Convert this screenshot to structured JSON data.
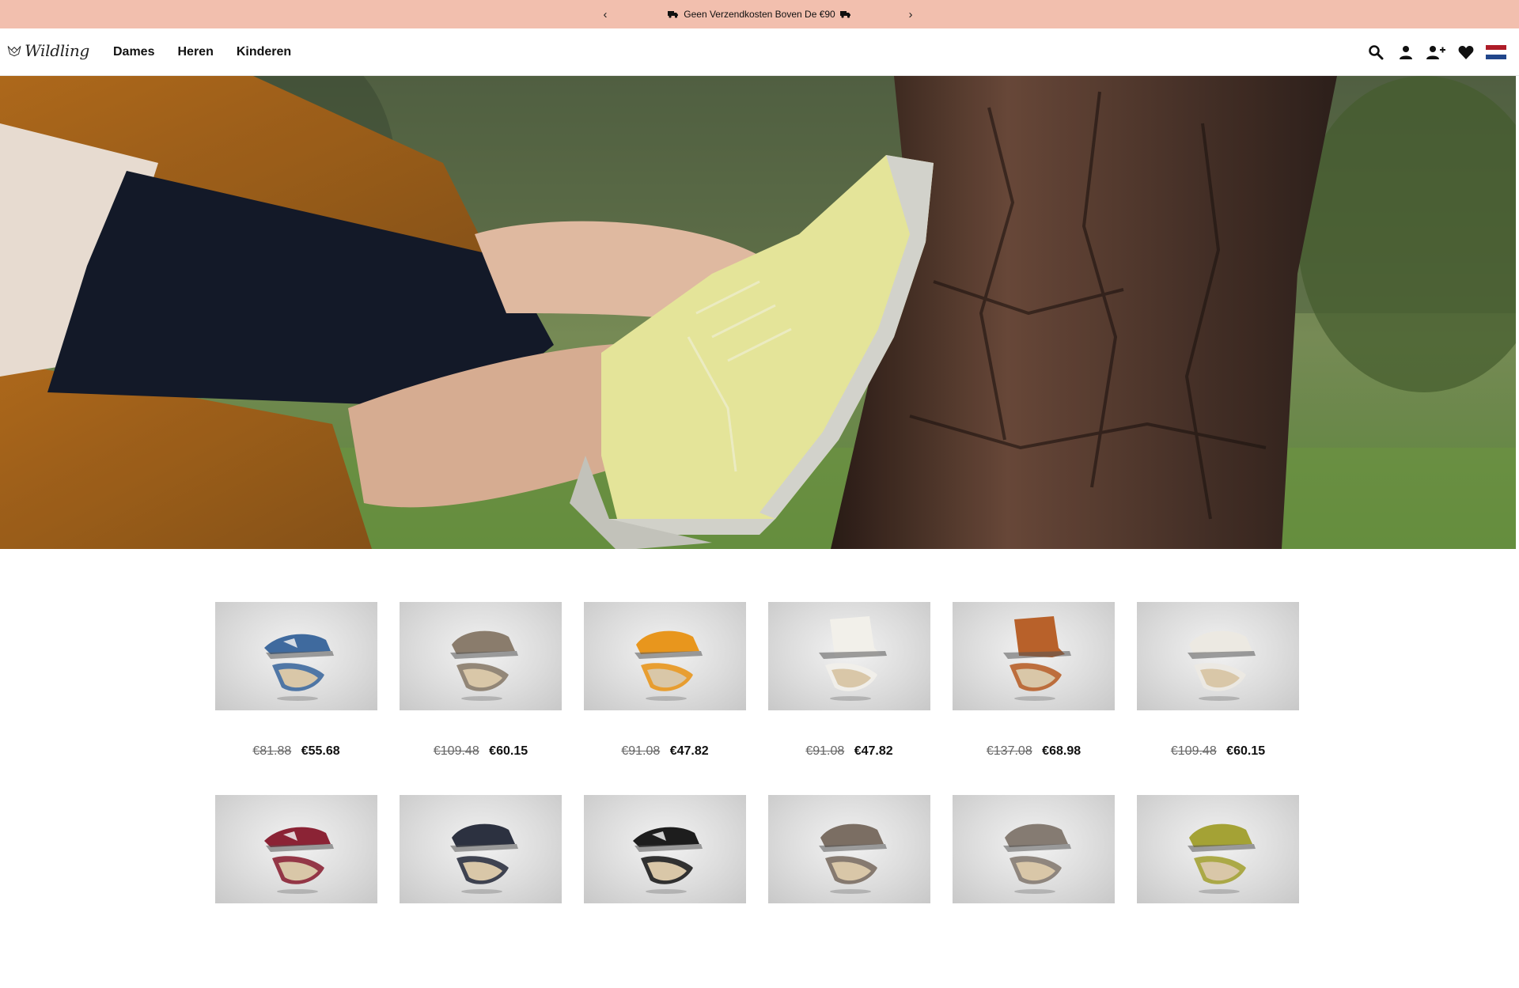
{
  "announcement": {
    "prev": "‹",
    "next": "›",
    "text": "Geen Verzendkosten Boven De €90"
  },
  "brand": {
    "name": "Wildling"
  },
  "nav": [
    {
      "label": "Dames"
    },
    {
      "label": "Heren"
    },
    {
      "label": "Kinderen"
    }
  ],
  "header_icons": [
    "search-icon",
    "account-icon",
    "register-icon",
    "wishlist-icon",
    "language-flag-nl"
  ],
  "products": [
    {
      "old_price": "€81.88",
      "price": "€55.68",
      "color": "#3f6a9e",
      "shape": "sandal"
    },
    {
      "old_price": "€109.48",
      "price": "€60.15",
      "color": "#8a7c6c",
      "shape": "low"
    },
    {
      "old_price": "€91.08",
      "price": "€47.82",
      "color": "#e8961d",
      "shape": "low"
    },
    {
      "old_price": "€91.08",
      "price": "€47.82",
      "color": "#f2f0ea",
      "shape": "high"
    },
    {
      "old_price": "€137.08",
      "price": "€68.98",
      "color": "#b8612a",
      "shape": "high"
    },
    {
      "old_price": "€109.48",
      "price": "€60.15",
      "color": "#ece9e2",
      "shape": "low"
    },
    {
      "old_price": "",
      "price": "",
      "color": "#8b2335",
      "shape": "sandal"
    },
    {
      "old_price": "",
      "price": "",
      "color": "#2c3140",
      "shape": "low"
    },
    {
      "old_price": "",
      "price": "",
      "color": "#1d1d1d",
      "shape": "sandal"
    },
    {
      "old_price": "",
      "price": "",
      "color": "#7b6e63",
      "shape": "low"
    },
    {
      "old_price": "",
      "price": "",
      "color": "#857b72",
      "shape": "low"
    },
    {
      "old_price": "",
      "price": "",
      "color": "#a4a235",
      "shape": "low"
    }
  ],
  "colors": {
    "announcement_bg": "#f2bfae",
    "text": "#111111"
  }
}
